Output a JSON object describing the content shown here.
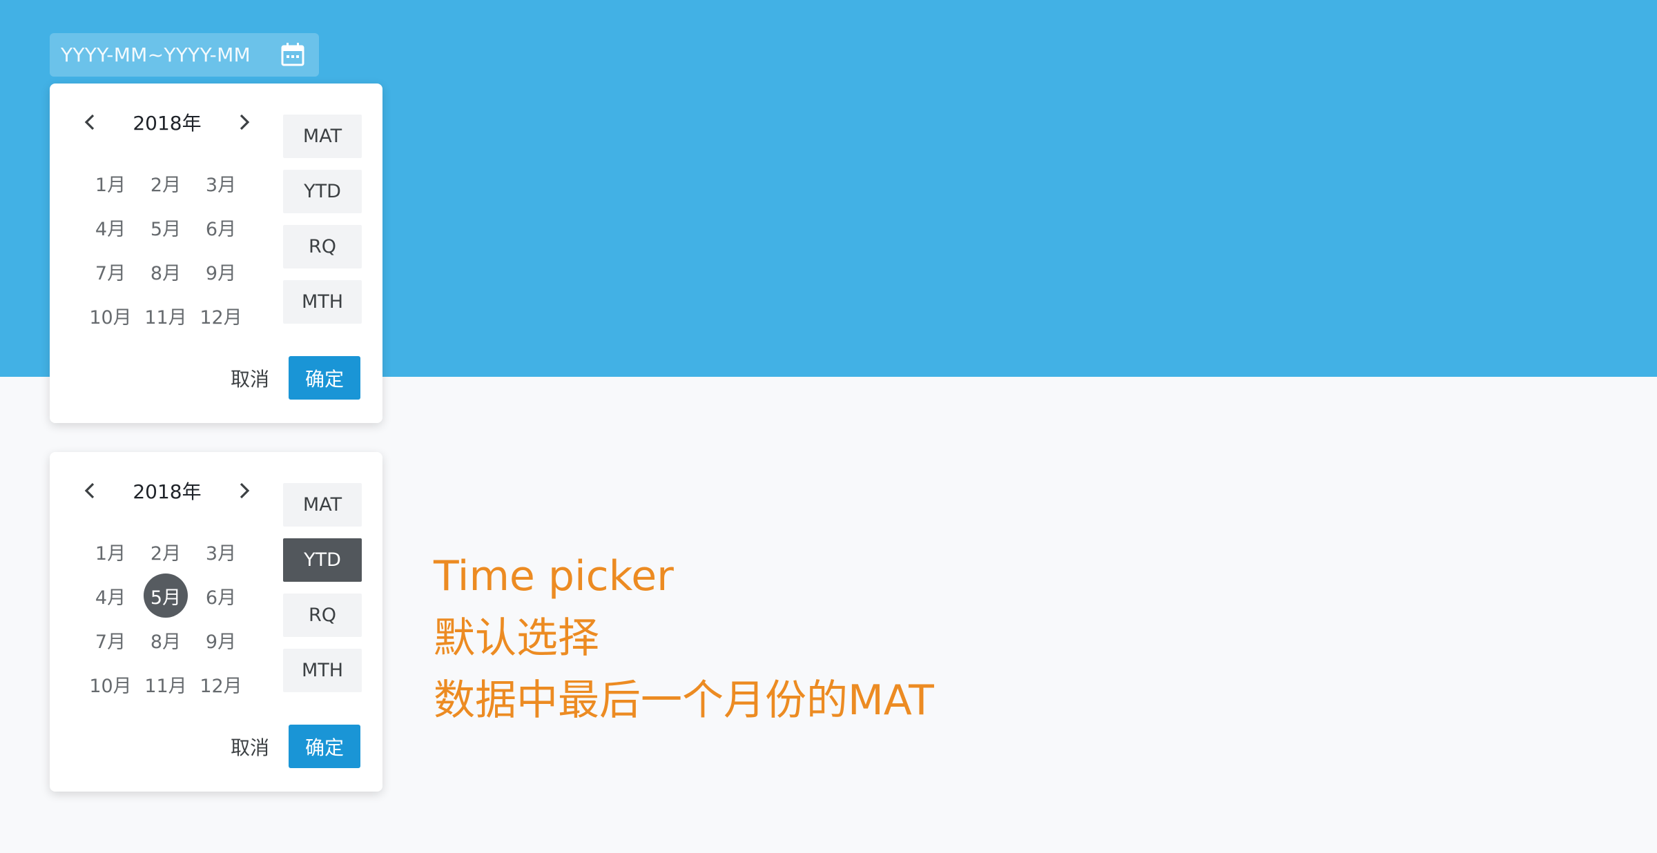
{
  "range_input": {
    "placeholder_text": "YYYY-MM~YYYY-MM",
    "icon": "calendar-icon"
  },
  "picker_1": {
    "year": "2018年",
    "months": [
      "1月",
      "2月",
      "3月",
      "4月",
      "5月",
      "6月",
      "7月",
      "8月",
      "9月",
      "10月",
      "11月",
      "12月"
    ],
    "selected_month": null,
    "periods": [
      "MAT",
      "YTD",
      "RQ",
      "MTH"
    ],
    "active_period": null,
    "cancel_label": "取消",
    "confirm_label": "确定"
  },
  "picker_2": {
    "year": "2018年",
    "months": [
      "1月",
      "2月",
      "3月",
      "4月",
      "5月",
      "6月",
      "7月",
      "8月",
      "9月",
      "10月",
      "11月",
      "12月"
    ],
    "selected_month": "5月",
    "periods": [
      "MAT",
      "YTD",
      "RQ",
      "MTH"
    ],
    "active_period": "YTD",
    "cancel_label": "取消",
    "confirm_label": "确定"
  },
  "annotation": {
    "line1": "Time picker",
    "line2": "默认选择",
    "line3": "数据中最后一个月份的MAT"
  },
  "colors": {
    "hero_bg": "#42b1e5",
    "page_bg": "#f8f9fb",
    "confirm_bg": "#1a95d6",
    "selected_bg": "#565b60",
    "annotation": "#ec8b22"
  }
}
